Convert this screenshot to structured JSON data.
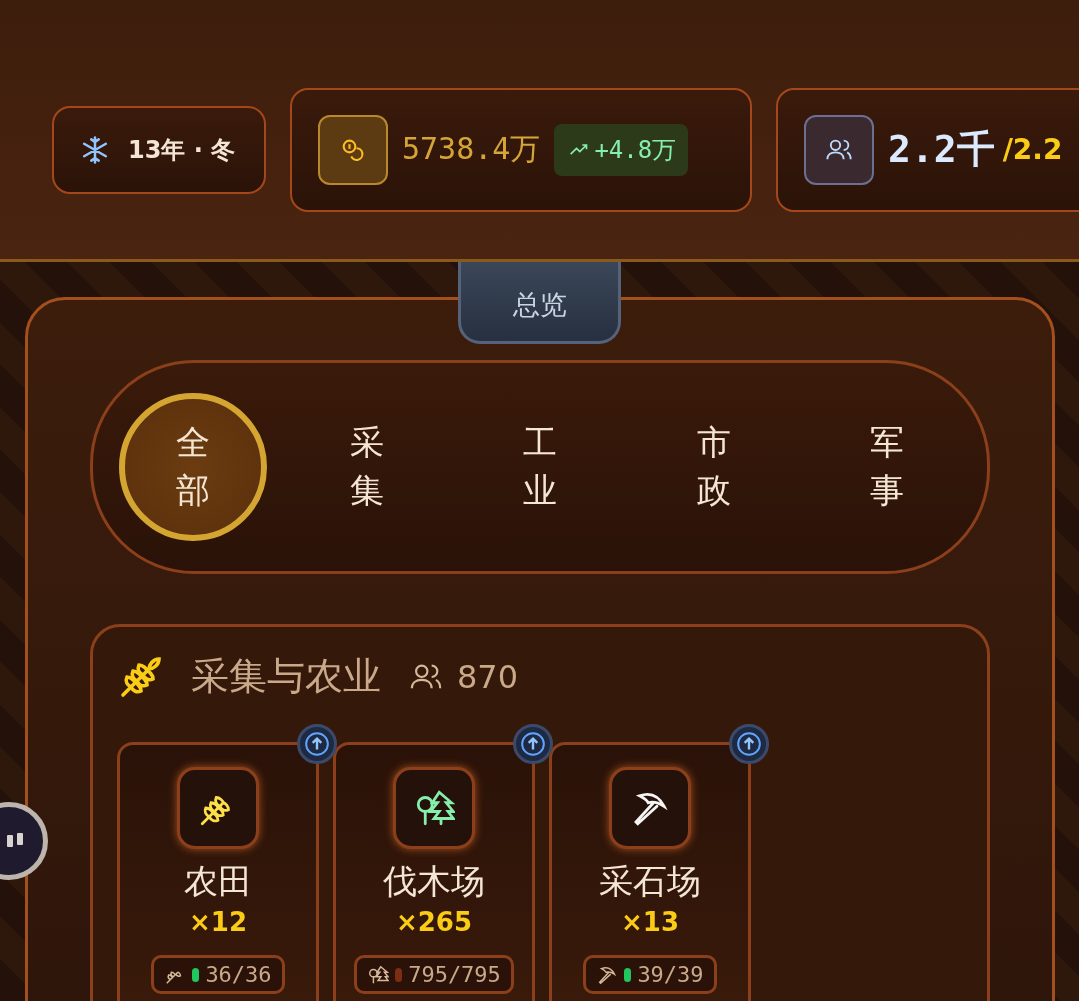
{
  "status_bar": {
    "date": "13年 · 冬",
    "gold": {
      "value": "5738.4万",
      "change": "+4.8万"
    },
    "population": {
      "value": "2.2千",
      "capacity": "/2.2"
    }
  },
  "overview_tab": {
    "label": "总览"
  },
  "categories": [
    {
      "label": "全部",
      "selected": true
    },
    {
      "label": "采集",
      "selected": false
    },
    {
      "label": "工业",
      "selected": false
    },
    {
      "label": "市政",
      "selected": false
    },
    {
      "label": "军事",
      "selected": false
    }
  ],
  "section": {
    "title": "采集与农业",
    "workers": "870",
    "buildings": [
      {
        "kind": "farm",
        "name": "农田",
        "count": "×12",
        "stock": "36/36",
        "color": "#22c55e"
      },
      {
        "kind": "lumber",
        "name": "伐木场",
        "count": "×265",
        "stock": "795/795",
        "color": "#7c2d12"
      },
      {
        "kind": "quarry",
        "name": "采石场",
        "count": "×13",
        "stock": "39/39",
        "color": "#22c55e"
      }
    ]
  }
}
